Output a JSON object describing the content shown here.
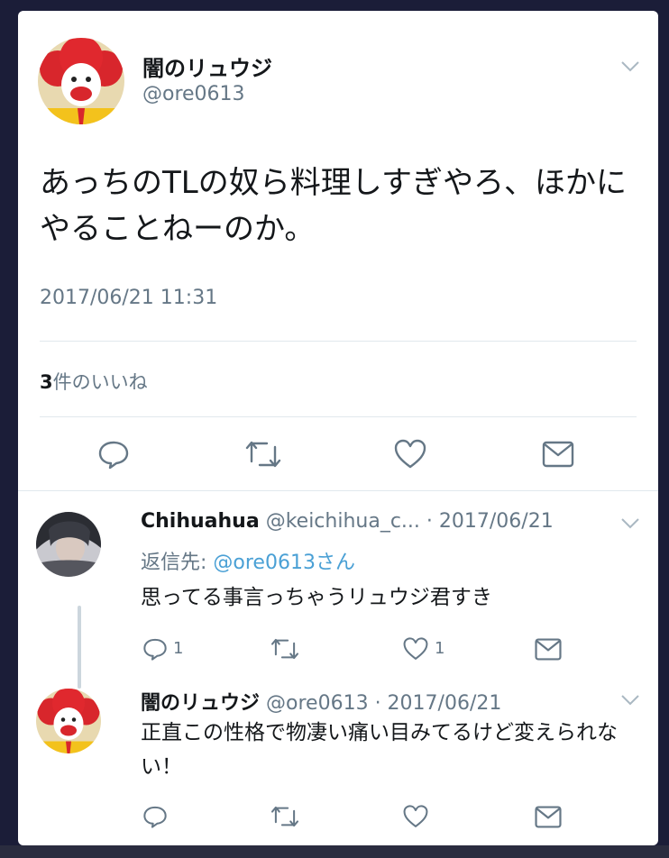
{
  "main_tweet": {
    "name": "闇のリュウジ",
    "handle": "@ore0613",
    "text": "あっちのTLの奴ら料理しすぎやろ、ほかにやることねーのか。",
    "timestamp": "2017/06/21 11:31",
    "likes_count": "3",
    "likes_label": "件のいいね"
  },
  "reply1": {
    "name": "Chihuahua",
    "handle": "@keichihua_c...",
    "date": "· 2017/06/21",
    "reply_to_label": "返信先: ",
    "reply_to_mention": "@ore0613さん",
    "text": "思ってる事言っちゃうリュウジ君すき",
    "reply_count": "1",
    "like_count": "1"
  },
  "reply2": {
    "name": "闇のリュウジ",
    "handle": "@ore0613",
    "date": "· 2017/06/21",
    "text": "正直この性格で物凄い痛い目みてるけど変えられない！"
  },
  "colors": {
    "background": "#1b1d38",
    "card": "#ffffff",
    "text": "#14171a",
    "muted": "#657786",
    "link": "#4aa0d5",
    "divider": "#e1e8ed"
  },
  "icons": [
    "reply-icon",
    "retweet-icon",
    "like-icon",
    "message-icon",
    "chevron-down-icon"
  ]
}
